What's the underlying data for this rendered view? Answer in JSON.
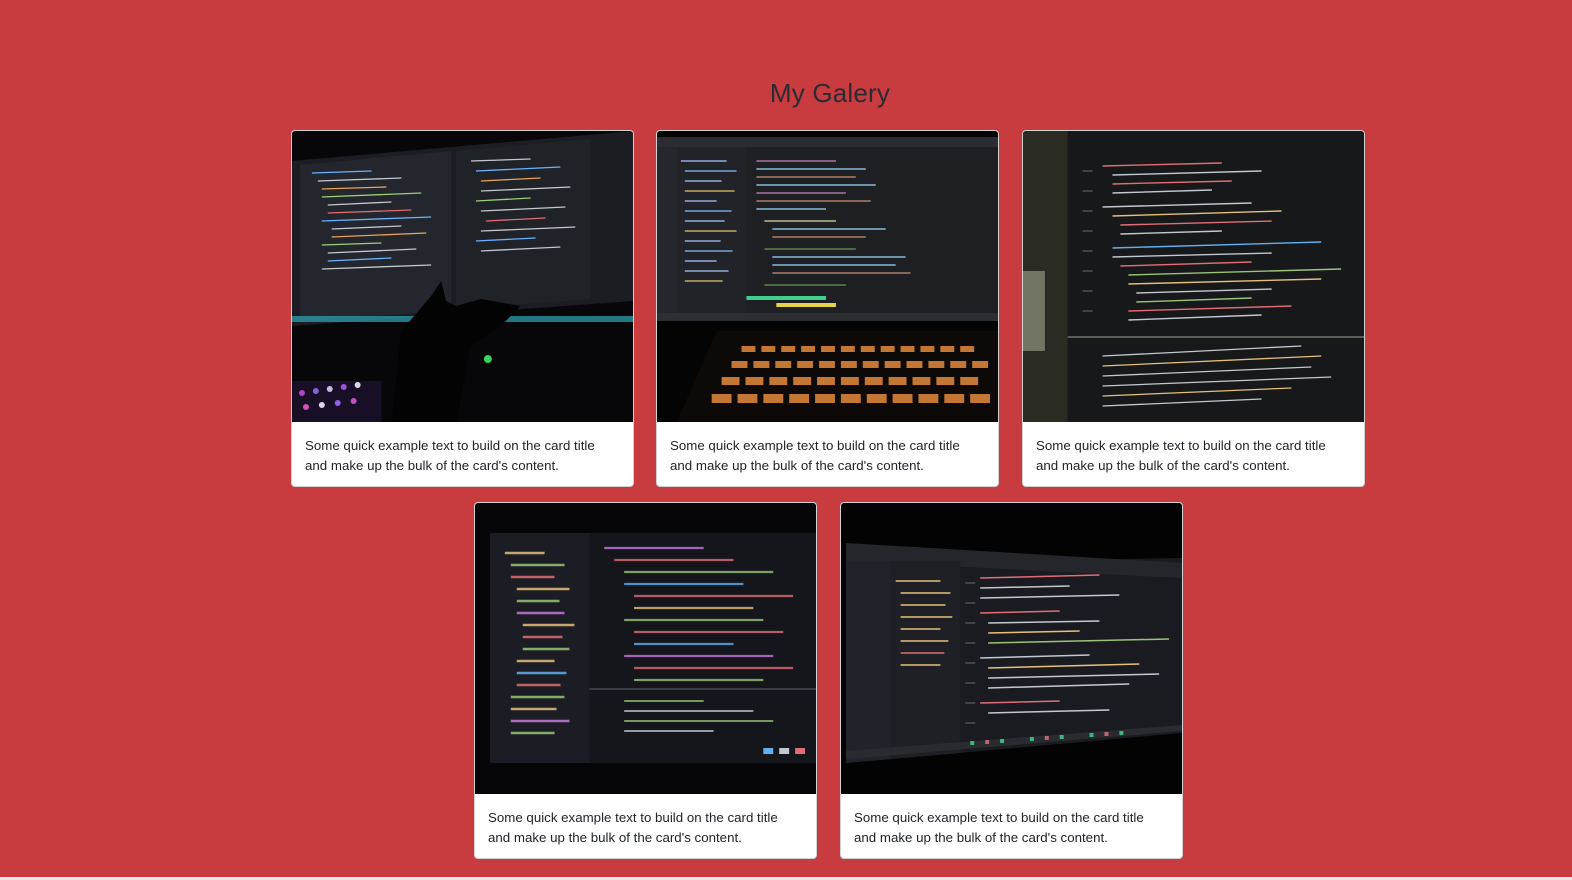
{
  "page": {
    "title": "My Galery"
  },
  "colors": {
    "background": "#c83b3f",
    "title": "#2b2b33",
    "card": "#ffffff"
  },
  "cards": [
    {
      "text": "Some quick example text to build on the card title and make up the bulk of the card's content."
    },
    {
      "text": "Some quick example text to build on the card title and make up the bulk of the card's content."
    },
    {
      "text": "Some quick example text to build on the card title and make up the bulk of the card's content."
    },
    {
      "text": "Some quick example text to build on the card title and make up the bulk of the card's content."
    },
    {
      "text": "Some quick example text to build on the card title and make up the bulk of the card's content."
    }
  ]
}
